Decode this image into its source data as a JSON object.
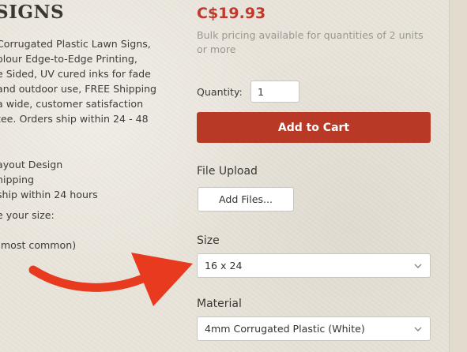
{
  "left": {
    "title": "SIGNS",
    "description_lines": [
      "Corrugated Plastic Lawn Signs,",
      "olour Edge-to-Edge Printing,",
      "e Sided, UV cured inks for fade",
      "and outdoor use, FREE Shipping",
      "a wide, customer satisfaction",
      "tee. Orders ship within 24 - 48"
    ],
    "features": [
      "ayout Design",
      "hipping",
      "ship within 24 hours",
      "e your size:",
      "(most common)"
    ]
  },
  "product": {
    "price": "C$19.93",
    "bulk_note": "Bulk pricing available for quantities of 2 units or more",
    "quantity_label": "Quantity:",
    "quantity_value": "1",
    "add_to_cart_label": "Add to Cart",
    "file_upload_label": "File Upload",
    "add_files_label": "Add Files...",
    "size_label": "Size",
    "size_value": "16 x 24",
    "material_label": "Material",
    "material_value": "4mm Corrugated Plastic (White)"
  },
  "colors": {
    "price": "#c0392b",
    "button": "#b83a26",
    "arrow": "#e83a1f",
    "background": "#e9e4da"
  },
  "icons": {
    "select_chevron": "chevron-down-icon",
    "annotation": "red-arrow-icon"
  }
}
